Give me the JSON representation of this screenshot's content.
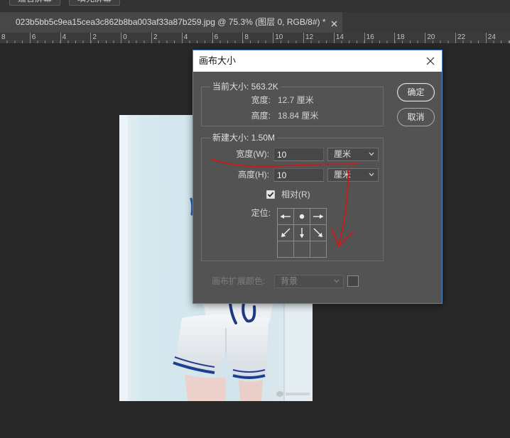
{
  "toolbar": {
    "fit_screen": "适合屏幕",
    "fill_screen": "填充屏幕"
  },
  "document_tab": {
    "title": "023b5bb5c9ea15cea3c862b8ba003af33a87b259.jpg @ 75.3% (图层 0, RGB/8#) *",
    "close_icon": "close-icon"
  },
  "ruler": {
    "labels": [
      "8",
      "6",
      "4",
      "2",
      "0",
      "2",
      "4",
      "6",
      "8",
      "10",
      "12",
      "14",
      "16",
      "18",
      "20",
      "22",
      "24"
    ]
  },
  "dialog": {
    "title": "画布大小",
    "close_icon": "close-icon",
    "current_size": {
      "legend": "当前大小: 563.2K",
      "width_label": "宽度:",
      "width_value": "12.7 厘米",
      "height_label": "高度:",
      "height_value": "18.84 厘米"
    },
    "buttons": {
      "ok": "确定",
      "cancel": "取消"
    },
    "new_size": {
      "legend": "新建大小: 1.50M",
      "width_label": "宽度(W):",
      "width_value": "10",
      "width_unit": "厘米",
      "height_label": "高度(H):",
      "height_value": "10",
      "height_unit": "厘米",
      "relative_label": "相对(R)",
      "relative_checked": true,
      "anchor_label": "定位:",
      "anchor_icons": [
        "arrow-left-icon",
        "anchor-dot-icon",
        "arrow-right-icon",
        "arrow-down-left-icon",
        "arrow-down-icon",
        "arrow-down-right-icon",
        "",
        "",
        ""
      ]
    },
    "extension_color": {
      "label": "画布扩展颜色:",
      "value": "背景",
      "enabled": false
    }
  },
  "colors": {
    "workspace": "#282828",
    "dialog_body": "#535353",
    "dialog_border": "#4a86c7",
    "annotation_red": "#cc1a1a"
  }
}
